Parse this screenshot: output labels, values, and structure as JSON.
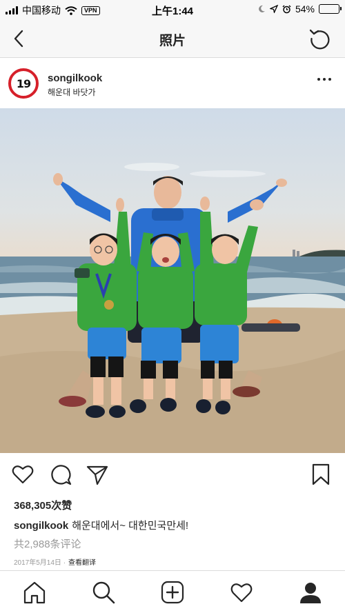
{
  "status_bar": {
    "carrier": "中国移动",
    "vpn_label": "VPN",
    "time": "上午1:44",
    "battery_percent": "54%",
    "battery_level": 0.54,
    "icons": [
      "signal-icon",
      "wifi-icon",
      "moon-icon",
      "location-arrow-icon",
      "alarm-icon",
      "battery-icon"
    ]
  },
  "header": {
    "title": "照片",
    "left_icon": "back-chevron-icon",
    "right_icon": "refresh-icon"
  },
  "post": {
    "avatar_text": "19",
    "username": "songilkook",
    "location": "해운대 바닷가",
    "more_icon": "more-dots-icon",
    "likes": "368,305次赞",
    "caption_user": "songilkook",
    "caption_text": "해운대에서~ 대한민국만세!",
    "comments": "共2,988条评论",
    "date": "2017年5月14日 ·",
    "translate": "查看翻译"
  },
  "actions": [
    "heart-icon",
    "comment-icon",
    "share-icon",
    "bookmark-icon"
  ],
  "tabbar": [
    "home-icon",
    "search-icon",
    "add-post-icon",
    "activity-heart-icon",
    "profile-icon"
  ],
  "colors": {
    "avatar_ring": "#d6202a",
    "jacket_green": "#3aa63e",
    "jacket_blue": "#2a6fd0",
    "sand": "#c9b394",
    "sea": "#6f8fa3"
  }
}
